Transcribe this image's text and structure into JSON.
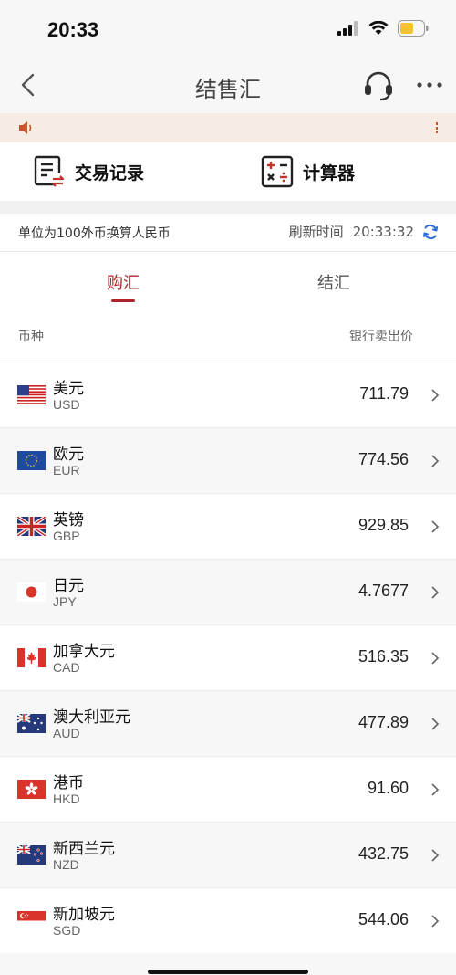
{
  "status_bar": {
    "time": "20:33"
  },
  "nav": {
    "title": "结售汇"
  },
  "quick_actions": {
    "records_label": "交易记录",
    "calculator_label": "计算器"
  },
  "info": {
    "unit_text": "单位为100外币换算人民币",
    "refresh_label": "刷新时间",
    "refresh_time": "20:33:32"
  },
  "tabs": {
    "buy": "购汇",
    "sell": "结汇"
  },
  "columns": {
    "currency": "币种",
    "price": "银行卖出价"
  },
  "currencies": [
    {
      "name": "美元",
      "code": "USD",
      "price": "711.79",
      "flag": "us-flag"
    },
    {
      "name": "欧元",
      "code": "EUR",
      "price": "774.56",
      "flag": "eu-flag"
    },
    {
      "name": "英镑",
      "code": "GBP",
      "price": "929.85",
      "flag": "uk-flag"
    },
    {
      "name": "日元",
      "code": "JPY",
      "price": "4.7677",
      "flag": "jp-flag"
    },
    {
      "name": "加拿大元",
      "code": "CAD",
      "price": "516.35",
      "flag": "ca-flag"
    },
    {
      "name": "澳大利亚元",
      "code": "AUD",
      "price": "477.89",
      "flag": "au-flag"
    },
    {
      "name": "港币",
      "code": "HKD",
      "price": "91.60",
      "flag": "hk-flag"
    },
    {
      "name": "新西兰元",
      "code": "NZD",
      "price": "432.75",
      "flag": "nz-flag"
    },
    {
      "name": "新加坡元",
      "code": "SGD",
      "price": "544.06",
      "flag": "sg-flag"
    }
  ],
  "colors": {
    "accent": "#b0242c",
    "refresh_icon": "#2b6fd6",
    "notice_bg": "#f7ece3",
    "battery": "#f2c230"
  }
}
